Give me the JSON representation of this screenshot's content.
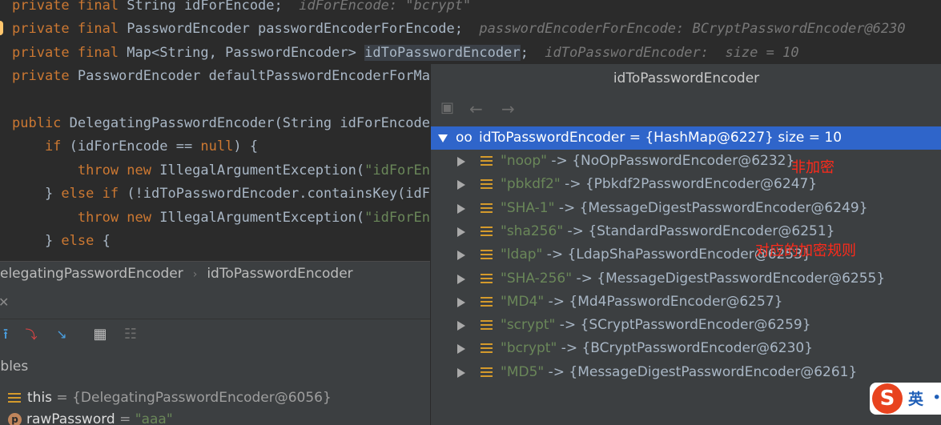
{
  "editor": {
    "lines": [
      {
        "segs": [
          {
            "t": "private final ",
            "c": "kw"
          },
          {
            "t": "String idForEncode;  ",
            "c": ""
          },
          {
            "t": "idForEncode: \"bcrypt\"",
            "c": "hint"
          }
        ]
      },
      {
        "segs": [
          {
            "t": "private final ",
            "c": "kw"
          },
          {
            "t": "PasswordEncoder passwordEncoderForEncode;  ",
            "c": ""
          },
          {
            "t": "passwordEncoderForEncode: BCryptPasswordEncoder@6230",
            "c": "hint"
          }
        ]
      },
      {
        "segs": [
          {
            "t": "private final ",
            "c": "kw"
          },
          {
            "t": "Map<String, PasswordEncoder> ",
            "c": ""
          },
          {
            "t": "idToPasswordEncoder",
            "c": "hl"
          },
          {
            "t": ";  ",
            "c": ""
          },
          {
            "t": "idToPasswordEncoder:  size = 10",
            "c": "hint"
          }
        ]
      },
      {
        "segs": [
          {
            "t": "private ",
            "c": "kw"
          },
          {
            "t": "PasswordEncoder defaultPasswordEncoderForMa",
            "c": ""
          }
        ]
      },
      {
        "segs": [
          {
            "t": "",
            "c": ""
          }
        ]
      },
      {
        "segs": [
          {
            "t": "public ",
            "c": "kw"
          },
          {
            "t": "DelegatingPasswordEncoder(String idForEncode",
            "c": ""
          }
        ]
      },
      {
        "segs": [
          {
            "t": "    if ",
            "c": "kw"
          },
          {
            "t": "(idForEncode == ",
            "c": ""
          },
          {
            "t": "null",
            "c": "kw"
          },
          {
            "t": ") {",
            "c": ""
          }
        ]
      },
      {
        "segs": [
          {
            "t": "        throw new ",
            "c": "kw"
          },
          {
            "t": "IllegalArgumentException(",
            "c": ""
          },
          {
            "t": "\"idForEn",
            "c": "str"
          }
        ]
      },
      {
        "segs": [
          {
            "t": "    } ",
            "c": ""
          },
          {
            "t": "else if ",
            "c": "kw"
          },
          {
            "t": "(!idToPasswordEncoder.containsKey(idF",
            "c": ""
          }
        ]
      },
      {
        "segs": [
          {
            "t": "        throw new ",
            "c": "kw"
          },
          {
            "t": "IllegalArgumentException(",
            "c": ""
          },
          {
            "t": "\"idForEn",
            "c": "str"
          }
        ]
      },
      {
        "segs": [
          {
            "t": "    } ",
            "c": ""
          },
          {
            "t": "else ",
            "c": "kw"
          },
          {
            "t": "{",
            "c": ""
          }
        ]
      }
    ]
  },
  "breadcrumb": {
    "class_name": "elegatingPasswordEncoder",
    "sep": "›",
    "field": "idToPasswordEncoder"
  },
  "debug": {
    "tab_label": "ables",
    "vars": [
      {
        "name": "this",
        "value": "{DelegatingPasswordEncoder@6056}"
      },
      {
        "name": "rawPassword",
        "value": "\"aaa\""
      }
    ]
  },
  "popup": {
    "title": "idToPasswordEncoder",
    "root": "idToPasswordEncoder = {HashMap@6227}  size = 10",
    "entries": [
      {
        "key": "\"noop\"",
        "value": " -> {NoOpPasswordEncoder@6232}"
      },
      {
        "key": "\"pbkdf2\"",
        "value": " -> {Pbkdf2PasswordEncoder@6247}"
      },
      {
        "key": "\"SHA-1\"",
        "value": " -> {MessageDigestPasswordEncoder@6249}"
      },
      {
        "key": "\"sha256\"",
        "value": " -> {StandardPasswordEncoder@6251}"
      },
      {
        "key": "\"ldap\"",
        "value": " -> {LdapShaPasswordEncoder@6253}"
      },
      {
        "key": "\"SHA-256\"",
        "value": " -> {MessageDigestPasswordEncoder@6255}"
      },
      {
        "key": "\"MD4\"",
        "value": " -> {Md4PasswordEncoder@6257}"
      },
      {
        "key": "\"scrypt\"",
        "value": " -> {SCryptPasswordEncoder@6259}"
      },
      {
        "key": "\"bcrypt\"",
        "value": " -> {BCryptPasswordEncoder@6230}"
      },
      {
        "key": "\"MD5\"",
        "value": " -> {MessageDigestPasswordEncoder@6261}"
      }
    ],
    "annotations": {
      "noop_note": "非加密",
      "rules_note": "对应的加密规则"
    }
  },
  "ime": {
    "logo": "S",
    "mode": "英"
  },
  "colors": {
    "selection": "#2f65ca",
    "annotation": "#ff2a1a",
    "keyword": "#cc7832",
    "string": "#6a8759"
  }
}
